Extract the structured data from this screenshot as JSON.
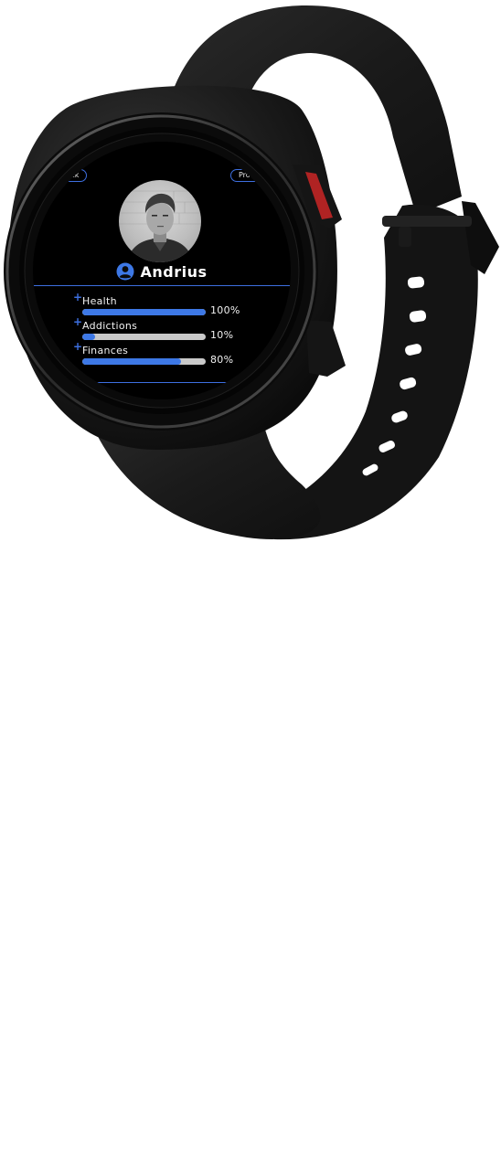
{
  "header": {
    "back_label": "Back",
    "profile_label": "Profile"
  },
  "user": {
    "name": "Andrius",
    "avatar_icon": "user-photo",
    "user_icon": "user-circle-icon"
  },
  "stats": [
    {
      "label": "Health",
      "value_text": "100%",
      "level": 1.0
    },
    {
      "label": "Addictions",
      "value_text": "10%",
      "level": 0.1
    },
    {
      "label": "Finances",
      "value_text": "80%",
      "level": 0.8
    }
  ],
  "colors": {
    "accent": "#3d6fe0",
    "bar_fill": "#3d78e6",
    "bar_track": "#c9c9c9",
    "screen_bg": "#000000",
    "watch_body": "#1e1e1e",
    "crown_accent": "#b02323"
  }
}
